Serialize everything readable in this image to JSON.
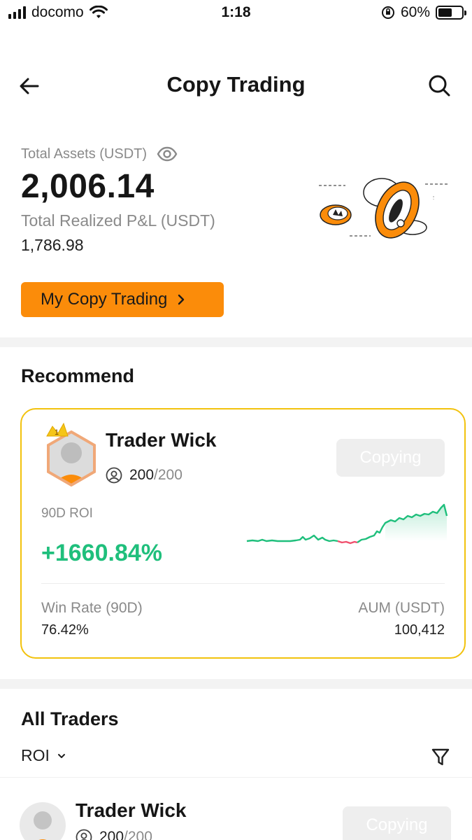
{
  "status_bar": {
    "carrier": "docomo",
    "time": "1:18",
    "battery": "60%",
    "battery_level": 0.6
  },
  "header": {
    "title": "Copy Trading"
  },
  "assets": {
    "total_label": "Total Assets (USDT)",
    "total_value": "2,006.14",
    "pnl_label": "Total Realized P&L (USDT)",
    "pnl_value": "1,786.98",
    "my_copy_button": "My Copy Trading"
  },
  "recommend": {
    "section_title": "Recommend",
    "trader": {
      "name": "Trader Wick",
      "rank": "1",
      "followers": "200",
      "followers_max": "/200",
      "button": "Copying",
      "roi_label": "90D ROI",
      "roi_value": "+1660.84%",
      "win_rate_label": "Win Rate (90D)",
      "win_rate_value": "76.42%",
      "aum_label": "AUM (USDT)",
      "aum_value": "100,412"
    }
  },
  "all_traders": {
    "section_title": "All Traders",
    "sort_label": "ROI",
    "rows": [
      {
        "name": "Trader Wick",
        "followers": "200",
        "followers_max": "/200",
        "button": "Copying"
      }
    ]
  },
  "colors": {
    "accent_orange": "#fb8c0a",
    "card_border": "#f2c20d",
    "profit_green": "#1fbf7c",
    "loss_red": "#f0506e"
  },
  "icons": {
    "back": "arrow-left-icon",
    "search": "search-icon",
    "eye": "eye-icon",
    "chevron": "chevron-right-icon",
    "user": "user-circle-icon",
    "sort": "chevron-down-icon",
    "filter": "filter-icon"
  }
}
